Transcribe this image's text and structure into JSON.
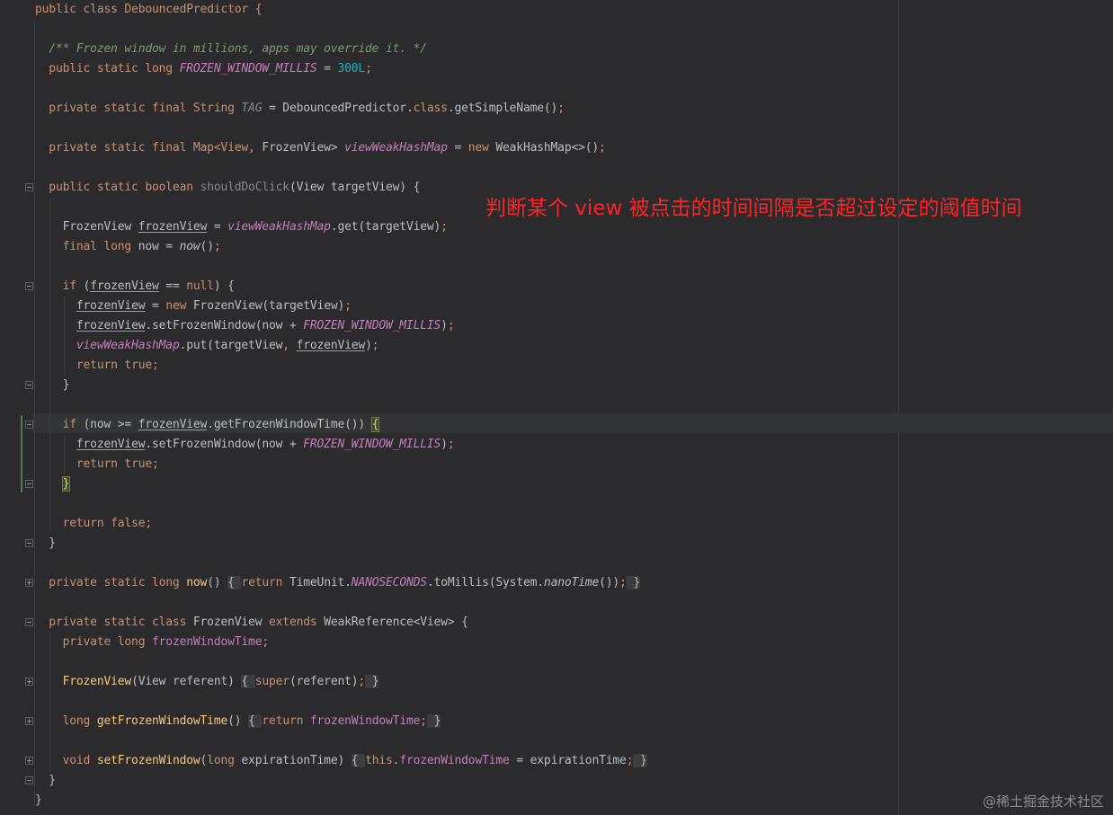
{
  "editor": {
    "lines": [
      [
        "public class DebouncedPredictor {"
      ],
      [],
      [
        "  /** Frozen window in millions, apps may override it. */"
      ],
      [
        "  public static long ",
        "FROZEN_WINDOW_MILLIS",
        " = ",
        "300L",
        ";"
      ],
      [],
      [
        "  private static final String ",
        "TAG",
        " = DebouncedPredictor.",
        "class",
        ".getSimpleName()",
        ";"
      ],
      [],
      [
        "  private static final Map<View",
        ", ",
        "FrozenView> ",
        "viewWeakHashMap",
        " = ",
        "new ",
        "WeakHashMap<>()",
        ";"
      ],
      [],
      [
        "  public static boolean ",
        "shouldDoClick",
        "(View targetView) {"
      ],
      [],
      [
        "    FrozenView ",
        "frozenView",
        " = ",
        "viewWeakHashMap",
        ".get(targetView)",
        ";"
      ],
      [
        "    final long ",
        "now = ",
        "now",
        "()",
        ";"
      ],
      [],
      [
        "    if ",
        "(",
        "frozenView",
        " == ",
        "null",
        ") {"
      ],
      [
        "      ",
        "frozenView",
        " = ",
        "new ",
        "FrozenView(targetView)",
        ";"
      ],
      [
        "      ",
        "frozenView",
        ".setFrozenWindow(now + ",
        "FROZEN_WINDOW_MILLIS",
        ")",
        ";"
      ],
      [
        "      ",
        "viewWeakHashMap",
        ".put(targetView",
        ", ",
        "frozenView",
        ")",
        ";"
      ],
      [
        "      ",
        "return ",
        "true",
        ";"
      ],
      [
        "    }"
      ],
      [],
      [
        "    if ",
        "(now >= ",
        "frozenView",
        ".getFrozenWindowTime()) ",
        "{"
      ],
      [
        "      ",
        "frozenView",
        ".setFrozenWindow(now + ",
        "FROZEN_WINDOW_MILLIS",
        ")",
        ";"
      ],
      [
        "      ",
        "return ",
        "true",
        ";"
      ],
      [
        "    ",
        "}"
      ],
      [],
      [
        "    return ",
        "false",
        ";"
      ],
      [
        "  }"
      ],
      [],
      [
        "  private static long ",
        "now",
        "() ",
        "{ ",
        "return ",
        "TimeUnit.",
        "NANOSECONDS",
        ".toMillis(System.",
        "nanoTime",
        "())",
        ";",
        " }"
      ],
      [],
      [
        "  private static class ",
        "FrozenView ",
        "extends ",
        "WeakReference<View> {"
      ],
      [
        "    private long ",
        "frozenWindowTime",
        ";"
      ],
      [],
      [
        "    ",
        "FrozenView",
        "(View referent) ",
        "{ ",
        "super",
        "(referent)",
        ";",
        " }"
      ],
      [],
      [
        "    long ",
        "getFrozenWindowTime",
        "() ",
        "{ ",
        "return ",
        "frozenWindowTime",
        ";",
        " }"
      ],
      [],
      [
        "    void ",
        "setFrozenWindow",
        "(",
        "long ",
        "expirationTime) ",
        "{ ",
        "this",
        ".",
        "frozenWindowTime",
        " = expirationTime",
        ";",
        " }"
      ],
      [
        "  }"
      ],
      [
        "}"
      ]
    ]
  },
  "annotation": {
    "text": "判断某个 view 被点击的时间间隔是否超过设定的阈值时间",
    "color": "#ff2424"
  },
  "watermark": {
    "text": "@稀土掘金技术社区"
  },
  "theme": {
    "background": "#2b2b2d",
    "keyword": "#cf8e6d",
    "comment": "#7a9e6b",
    "number": "#2aacb8",
    "field": "#c77dbb",
    "text": "#bcbec4"
  }
}
